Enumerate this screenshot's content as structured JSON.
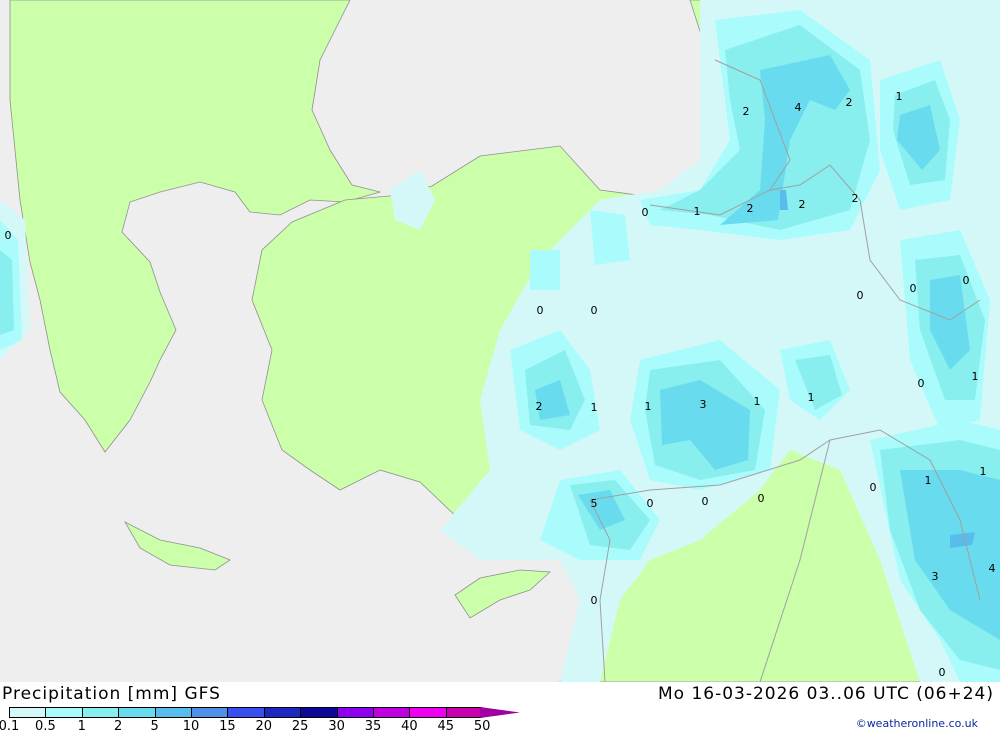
{
  "title": "Precipitation [mm] GFS",
  "datetime": "Mo 16-03-2026 03..06 UTC (06+24)",
  "credit": "©weatheronline.co.uk",
  "colors": {
    "sea": "#eeeeee",
    "land": "#ccffaa",
    "border": "#a0a0a0"
  },
  "legend": [
    {
      "label": "0.1",
      "color": "#d4f8f8"
    },
    {
      "label": "0.5",
      "color": "#aafcfc"
    },
    {
      "label": "1",
      "color": "#88eeee"
    },
    {
      "label": "2",
      "color": "#68dcee"
    },
    {
      "label": "5",
      "color": "#58bcec"
    },
    {
      "label": "10",
      "color": "#5090e8"
    },
    {
      "label": "15",
      "color": "#3850f0"
    },
    {
      "label": "20",
      "color": "#1c28c0"
    },
    {
      "label": "25",
      "color": "#0c0898"
    },
    {
      "label": "30",
      "color": "#9000f0"
    },
    {
      "label": "35",
      "color": "#c000e0"
    },
    {
      "label": "40",
      "color": "#f000f0"
    },
    {
      "label": "45",
      "color": "#c800b0"
    },
    {
      "label": "50",
      "color": "#a000a0"
    }
  ],
  "map": {
    "labels": [
      "0",
      "2",
      "4",
      "2",
      "1",
      "0",
      "1",
      "2",
      "2",
      "2",
      "0",
      "0",
      "0",
      "0",
      "0",
      "2",
      "1",
      "1",
      "3",
      "1",
      "1",
      "0",
      "1",
      "0",
      "1",
      "1",
      "5",
      "0",
      "0",
      "0",
      "3",
      "4",
      "0",
      "0"
    ]
  }
}
